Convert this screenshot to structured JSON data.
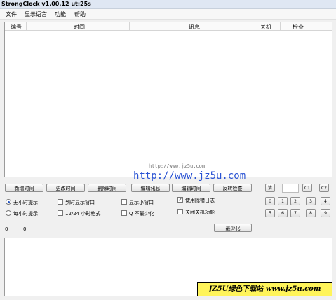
{
  "window": {
    "title": "StrongClock v1.00.12 ut:25s"
  },
  "menu": [
    "文件",
    "显示语言",
    "功能",
    "帮助"
  ],
  "table": {
    "columns": [
      "编号",
      "时间",
      "讯息",
      "关机",
      "检查"
    ]
  },
  "watermark": {
    "small": "http://www.jz5u.com",
    "big": "http://www.jz5u.com"
  },
  "buttons": [
    "新增时间",
    "更改时间",
    "删除时间",
    "编辑讯息",
    "编辑时间",
    "反转检查"
  ],
  "options": {
    "radio_no_hour": "无小时提示",
    "radio_every_hour": "每小时提示",
    "cb_show_window": "到时显示窗口",
    "cb_12_24": "12/24 小时格式",
    "cb_small_window": "显示小窗口",
    "cb_q_min": "Q 不最少化",
    "cb_log": "使用除错日志",
    "cb_shutdown": "关闭关机功能"
  },
  "keypad": {
    "clear": "清",
    "c1": "C1",
    "c2": "C2",
    "row1": [
      "0",
      "1",
      "2",
      "3",
      "4"
    ],
    "row2": [
      "5",
      "6",
      "7",
      "8",
      "9"
    ]
  },
  "counters": [
    "0",
    "0"
  ],
  "minimize_button": "最少化",
  "banner": "JZ5U绿色下载站 www.jz5u.com",
  "state": {
    "radio_no_hour": true,
    "cb_log": true
  }
}
